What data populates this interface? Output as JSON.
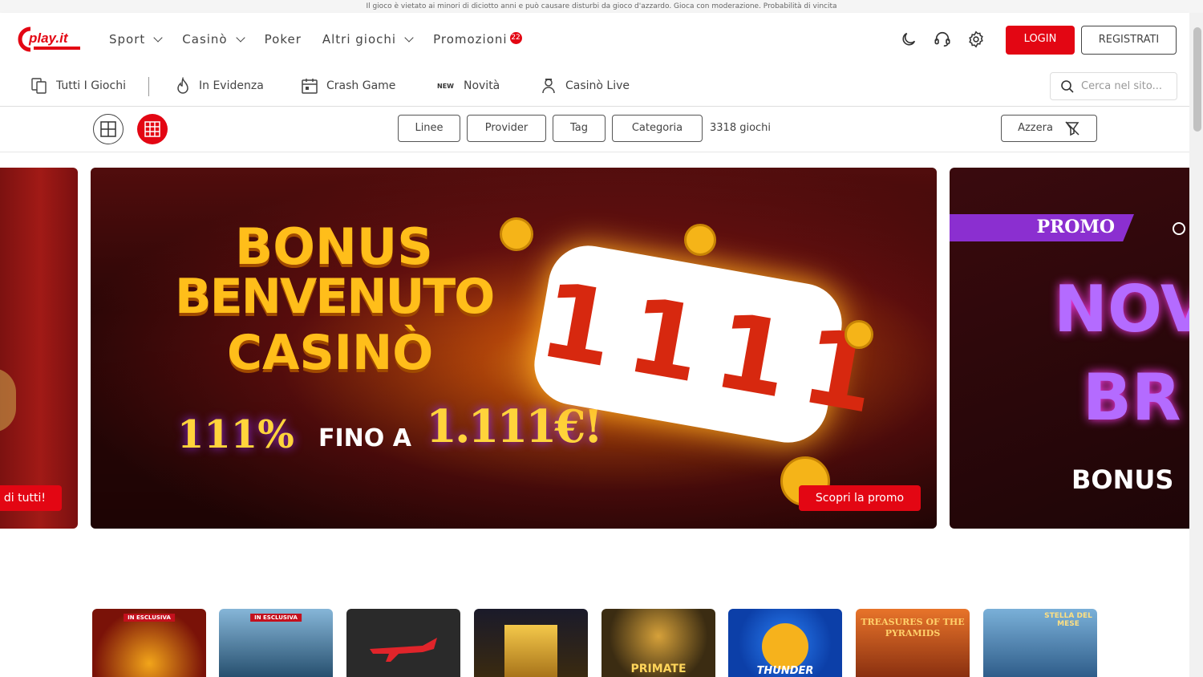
{
  "disclaimer": "Il gioco è vietato ai minori di diciotto anni e può causare disturbi da gioco d'azzardo. Gioca con moderazione. Probabilità di vincita",
  "logo": {
    "brand_text": "play.it",
    "brand_color": "#e30613"
  },
  "nav": {
    "sport": "Sport",
    "casino": "Casinò",
    "poker": "Poker",
    "altri_giochi": "Altri giochi",
    "promozioni": "Promozioni",
    "promo_count": "22"
  },
  "header_icons": [
    "moon-icon",
    "headset-icon",
    "settings-icon"
  ],
  "buttons": {
    "login": "LOGIN",
    "registrati": "REGISTRATI"
  },
  "subnav": {
    "tutti": "Tutti I Giochi",
    "evidenza": "In Evidenza",
    "crash": "Crash Game",
    "new_tag": "NEW",
    "novita": "Novità",
    "live": "Casinò Live",
    "search_placeholder": "Cerca nel sito..."
  },
  "filters": {
    "linee": "Linee",
    "provider": "Provider",
    "tag": "Tag",
    "categoria": "Categoria",
    "count": "3318 giochi",
    "azzera": "Azzera"
  },
  "carousel": {
    "left_cta": "di tutti!",
    "main": {
      "line1": "BONUS",
      "line2": "BENVENUTO",
      "line3": "CASINÒ",
      "percent": "111%",
      "fino": "FINO A",
      "amount": "1.111€!",
      "reel": "1111",
      "cta": "Scopri la promo"
    },
    "right": {
      "promo_tag": "PROMO",
      "line1": "NOV",
      "line2": "BR",
      "line3": "BONUS"
    }
  },
  "tiles": [
    {
      "name": "",
      "badge": "IN ESCLUSIVA",
      "bg": "#7a1208"
    },
    {
      "name": "",
      "badge": "IN ESCLUSIVA",
      "bg": "#27506f"
    },
    {
      "name": "",
      "badge": "",
      "bg": "#2a2a2a"
    },
    {
      "name": "",
      "badge": "",
      "bg": "#3a2a10"
    },
    {
      "name": "PRIMATE",
      "badge": "",
      "bg": "#3b2c12"
    },
    {
      "name": "THUNDER",
      "badge": "",
      "bg": "#0c3fa8"
    },
    {
      "name": "TREASURES OF THE PYRAMIDS",
      "badge": "",
      "bg": "#d85a18"
    },
    {
      "name": "STELLA DEL MESE",
      "badge": "",
      "bg": "#2f5d8a"
    }
  ],
  "colors": {
    "accent": "#e30613",
    "text": "#444444"
  }
}
